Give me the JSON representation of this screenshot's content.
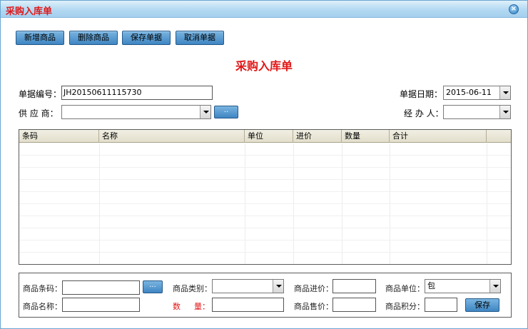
{
  "window": {
    "title": "采购入库单",
    "close_label": "×"
  },
  "toolbar": {
    "add": "新增商品",
    "delete": "删除商品",
    "save": "保存单据",
    "cancel": "取消单据"
  },
  "form": {
    "heading": "采购入库单",
    "doc_no_label": "单据编号：",
    "doc_no_value": "JH20150611115730",
    "date_label": "单据日期：",
    "date_value": "2015-06-11",
    "supplier_label": "供 应 商：",
    "supplier_value": "",
    "supplier_browse": "..",
    "handler_label": "经 办 人：",
    "handler_value": ""
  },
  "table": {
    "columns": [
      "条码",
      "名称",
      "单位",
      "进价",
      "数量",
      "合计",
      ""
    ]
  },
  "detail": {
    "barcode_label": "商品条码：",
    "barcode_browse": "...",
    "category_label": "商品类别：",
    "category_value": "",
    "cost_label": "商品进价：",
    "unit_label": "商品单位：",
    "unit_value": "包",
    "name_label": "商品名称：",
    "qty_label_1": "数",
    "qty_label_2": "量：",
    "price_label": "商品售价：",
    "points_label": "商品积分：",
    "save_label": "保存"
  },
  "colors": {
    "accent_red": "#e11818",
    "button_blue": "#3f86c3",
    "title_bar": "#b3d9f2"
  }
}
